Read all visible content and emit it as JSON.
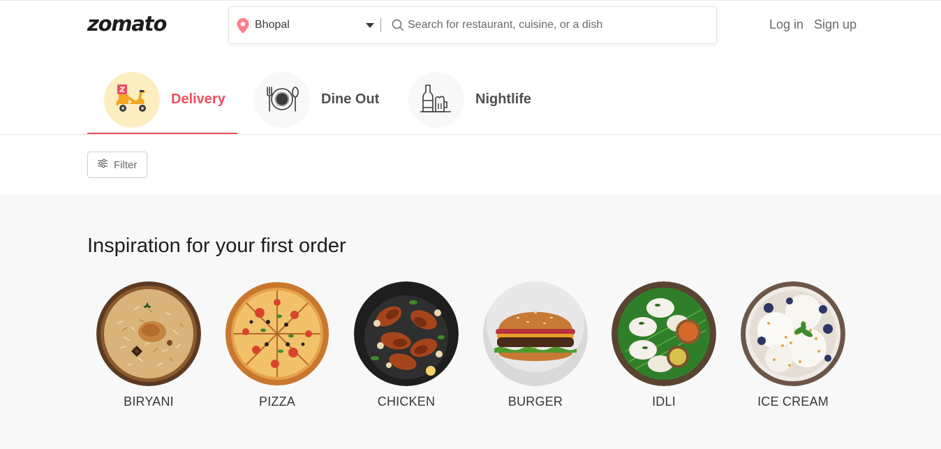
{
  "header": {
    "logo": "zomato",
    "location": "Bhopal",
    "search_placeholder": "Search for restaurant, cuisine, or a dish",
    "login": "Log in",
    "signup": "Sign up"
  },
  "tabs": [
    {
      "label": "Delivery",
      "active": true,
      "icon": "scooter-icon"
    },
    {
      "label": "Dine Out",
      "active": false,
      "icon": "plate-cutlery-icon"
    },
    {
      "label": "Nightlife",
      "active": false,
      "icon": "bottle-mug-icon"
    }
  ],
  "filter": {
    "label": "Filter",
    "icon": "sliders-icon"
  },
  "inspiration": {
    "title": "Inspiration for your first order",
    "items": [
      {
        "label": "BIRYANI"
      },
      {
        "label": "PIZZA"
      },
      {
        "label": "CHICKEN"
      },
      {
        "label": "BURGER"
      },
      {
        "label": "IDLI"
      },
      {
        "label": "ICE CREAM"
      }
    ]
  },
  "colors": {
    "accent": "#ef4f5f",
    "delivery_bg": "#fdeec2",
    "section_bg": "#f8f8f8"
  }
}
